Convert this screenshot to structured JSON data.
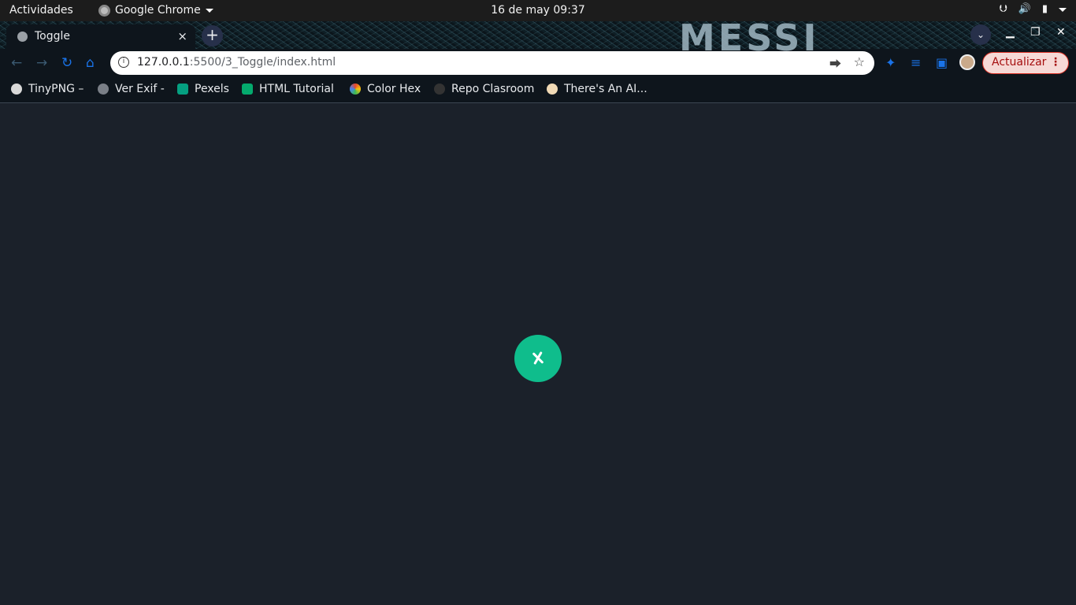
{
  "topbar": {
    "activities": "Actividades",
    "app_name": "Google Chrome",
    "clock": "16 de may  09:37"
  },
  "tabs": [
    {
      "title": "Toggle",
      "close": "×"
    }
  ],
  "newtab_symbol": "+",
  "wallpaper_text": "MESSI",
  "toolbar": {
    "url_host": "127.0.0.1",
    "url_rest": ":5500/3_Toggle/index.html",
    "update_label": "Actualizar"
  },
  "bookmarks": [
    {
      "label": "TinyPNG –",
      "icon": "panda-icon",
      "color": "#d9d9d9"
    },
    {
      "label": "Ver Exif -",
      "icon": "globe-icon",
      "color": "#7a7f87"
    },
    {
      "label": "Pexels",
      "icon": "pexels-icon",
      "color": "#05a081"
    },
    {
      "label": "HTML Tutorial",
      "icon": "w3schools-icon",
      "color": "#04aa6d"
    },
    {
      "label": "Color Hex",
      "icon": "colorhex-icon",
      "color": "#e8452c"
    },
    {
      "label": "Repo Clasroom",
      "icon": "github-icon",
      "color": "#333333"
    },
    {
      "label": "There's An AI...",
      "icon": "arm-icon",
      "color": "#f0d9b5"
    }
  ],
  "colors": {
    "page_bg": "#1b212a",
    "toggle_bg": "#0fbd8c",
    "accent": "#1a73e8"
  }
}
